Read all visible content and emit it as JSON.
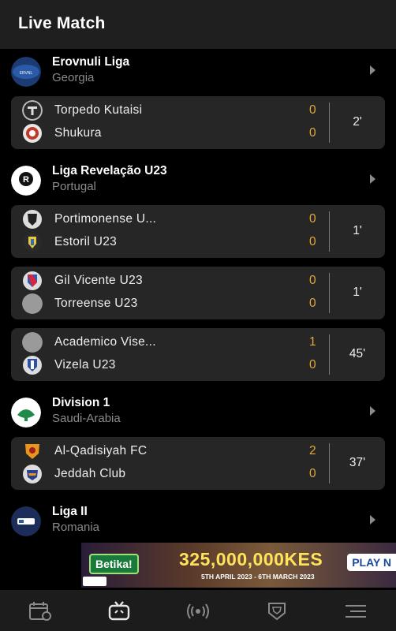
{
  "app": {
    "title": "Live Match"
  },
  "colors": {
    "score": "#e2a93b",
    "background": "#000000",
    "card": "#262626",
    "muted": "#8a8a8a"
  },
  "leagues": [
    {
      "name": "Erovnuli Liga",
      "country": "Georgia",
      "logo_icon": "erovnuli-liga-logo",
      "matches": [
        {
          "home": "Torpedo Kutaisi",
          "home_score": "0",
          "away": "Shukura",
          "away_score": "0",
          "minute": "2'"
        }
      ]
    },
    {
      "name": "Liga Revelação U23",
      "country": "Portugal",
      "logo_icon": "liga-revelacao-logo",
      "matches": [
        {
          "home": "Portimonense U...",
          "home_score": "0",
          "away": "Estoril U23",
          "away_score": "0",
          "minute": "1'"
        },
        {
          "home": "Gil Vicente U23",
          "home_score": "0",
          "away": "Torreense U23",
          "away_score": "0",
          "minute": "1'"
        },
        {
          "home": "Academico Vise...",
          "home_score": "1",
          "away": "Vizela U23",
          "away_score": "0",
          "minute": "45'"
        }
      ]
    },
    {
      "name": "Division 1",
      "country": "Saudi-Arabia",
      "logo_icon": "saudi-division-1-logo",
      "matches": [
        {
          "home": "Al-Qadisiyah FC",
          "home_score": "2",
          "away": "Jeddah Club",
          "away_score": "0",
          "minute": "37'"
        }
      ]
    },
    {
      "name": "Liga II",
      "country": "Romania",
      "logo_icon": "liga-ii-logo",
      "matches": []
    }
  ],
  "ad": {
    "brand": "Betika!",
    "amount": "325,000,000KES",
    "dates": "5TH APRIL 2023 - 6TH MARCH 2023",
    "cta": "PLAY N"
  },
  "bottom_nav": [
    {
      "icon": "calendar-icon"
    },
    {
      "icon": "live-tv-icon"
    },
    {
      "icon": "broadcast-icon"
    },
    {
      "icon": "trophy-icon"
    },
    {
      "icon": "menu-icon"
    }
  ]
}
